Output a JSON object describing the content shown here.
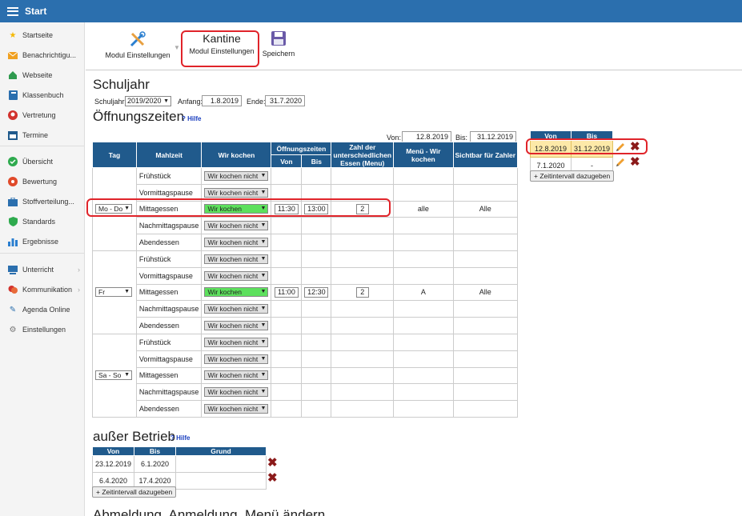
{
  "topbar": {
    "title": "Start"
  },
  "sidebar": {
    "items": [
      {
        "label": "Startseite",
        "icon": "star-icon"
      },
      {
        "label": "Benachrichtigu...",
        "icon": "envelope-icon"
      },
      {
        "label": "Webseite",
        "icon": "home-icon"
      },
      {
        "label": "Klassenbuch",
        "icon": "book-icon"
      },
      {
        "label": "Vertretung",
        "icon": "person-icon"
      },
      {
        "label": "Termine",
        "icon": "calendar-icon"
      },
      {
        "label": "Übersicht",
        "icon": "check-circle-icon"
      },
      {
        "label": "Bewertung",
        "icon": "grade-icon"
      },
      {
        "label": "Stoffverteilung...",
        "icon": "briefcase-icon"
      },
      {
        "label": "Standards",
        "icon": "shield-icon"
      },
      {
        "label": "Ergebnisse",
        "icon": "bar-chart-icon"
      },
      {
        "label": "Unterricht",
        "icon": "classroom-icon"
      },
      {
        "label": "Kommunikation",
        "icon": "chat-icon"
      },
      {
        "label": "Agenda Online",
        "icon": "pen-icon"
      },
      {
        "label": "Einstellungen",
        "icon": "gear-icon"
      }
    ]
  },
  "toolbar": {
    "modul_label": "Modul Einstellungen",
    "kantine_title": "Kantine",
    "kantine_sub": "Modul Einstellungen",
    "save_label": "Speichern"
  },
  "schuljahr": {
    "title": "Schuljahr",
    "label": "Schuljahr:",
    "value": "2019/2020",
    "anfang_label": "Anfang:",
    "anfang": "1.8.2019",
    "ende_label": "Ende:",
    "ende": "31.7.2020"
  },
  "oeffnung": {
    "title": "Öffnungszeiten",
    "hilfe": "Hilfe",
    "von_label": "Von:",
    "von": "12.8.2019",
    "bis_label": "Bis:",
    "bis": "31.12.2019",
    "headers": {
      "tag": "Tag",
      "mahlzeit": "Mahlzeit",
      "wir_kochen": "Wir kochen",
      "oeffnungszeiten": "Öffnungszeiten",
      "von": "Von",
      "bis": "Bis",
      "zahl": "Zahl der unterschiedlichen Essen (Menu)",
      "menu": "Menü - Wir kochen",
      "sichtbar": "Sichtbar für Zahler"
    },
    "groups": [
      {
        "tag": "Mo - Do",
        "rows": [
          {
            "meal": "Frühstück",
            "kochen": "Wir kochen nicht",
            "green": false,
            "von": "",
            "bis": "",
            "zahl": "",
            "menu": "",
            "sichtbar": ""
          },
          {
            "meal": "Vormittagspause",
            "kochen": "Wir kochen nicht",
            "green": false,
            "von": "",
            "bis": "",
            "zahl": "",
            "menu": "",
            "sichtbar": ""
          },
          {
            "meal": "Mittagessen",
            "kochen": "Wir kochen",
            "green": true,
            "von": "11:30",
            "bis": "13:00",
            "zahl": "2",
            "menu": "alle",
            "sichtbar": "Alle"
          },
          {
            "meal": "Nachmittagspause",
            "kochen": "Wir kochen nicht",
            "green": false,
            "von": "",
            "bis": "",
            "zahl": "",
            "menu": "",
            "sichtbar": ""
          },
          {
            "meal": "Abendessen",
            "kochen": "Wir kochen nicht",
            "green": false,
            "von": "",
            "bis": "",
            "zahl": "",
            "menu": "",
            "sichtbar": ""
          }
        ]
      },
      {
        "tag": "Fr",
        "rows": [
          {
            "meal": "Frühstück",
            "kochen": "Wir kochen nicht",
            "green": false,
            "von": "",
            "bis": "",
            "zahl": "",
            "menu": "",
            "sichtbar": ""
          },
          {
            "meal": "Vormittagspause",
            "kochen": "Wir kochen nicht",
            "green": false,
            "von": "",
            "bis": "",
            "zahl": "",
            "menu": "",
            "sichtbar": ""
          },
          {
            "meal": "Mittagessen",
            "kochen": "Wir kochen",
            "green": true,
            "von": "11:00",
            "bis": "12:30",
            "zahl": "2",
            "menu": "A",
            "sichtbar": "Alle"
          },
          {
            "meal": "Nachmittagspause",
            "kochen": "Wir kochen nicht",
            "green": false,
            "von": "",
            "bis": "",
            "zahl": "",
            "menu": "",
            "sichtbar": ""
          },
          {
            "meal": "Abendessen",
            "kochen": "Wir kochen nicht",
            "green": false,
            "von": "",
            "bis": "",
            "zahl": "",
            "menu": "",
            "sichtbar": ""
          }
        ]
      },
      {
        "tag": "Sa - So",
        "rows": [
          {
            "meal": "Frühstück",
            "kochen": "Wir kochen nicht",
            "green": false,
            "von": "",
            "bis": "",
            "zahl": "",
            "menu": "",
            "sichtbar": ""
          },
          {
            "meal": "Vormittagspause",
            "kochen": "Wir kochen nicht",
            "green": false,
            "von": "",
            "bis": "",
            "zahl": "",
            "menu": "",
            "sichtbar": ""
          },
          {
            "meal": "Mittagessen",
            "kochen": "Wir kochen nicht",
            "green": false,
            "von": "",
            "bis": "",
            "zahl": "",
            "menu": "",
            "sichtbar": ""
          },
          {
            "meal": "Nachmittagspause",
            "kochen": "Wir kochen nicht",
            "green": false,
            "von": "",
            "bis": "",
            "zahl": "",
            "menu": "",
            "sichtbar": ""
          },
          {
            "meal": "Abendessen",
            "kochen": "Wir kochen nicht",
            "green": false,
            "von": "",
            "bis": "",
            "zahl": "",
            "menu": "",
            "sichtbar": ""
          }
        ]
      }
    ]
  },
  "intervals": {
    "headers": {
      "von": "Von",
      "bis": "Bis"
    },
    "rows": [
      {
        "von": "12.8.2019",
        "bis": "31.12.2019"
      },
      {
        "von": "7.1.2020",
        "bis": "-"
      }
    ],
    "add_label": "+ Zeitintervall dazugeben"
  },
  "ausser": {
    "title": "außer Betrieb",
    "hilfe": "Hilfe",
    "headers": {
      "von": "Von",
      "bis": "Bis",
      "grund": "Grund"
    },
    "rows": [
      {
        "von": "23.12.2019",
        "bis": "6.1.2020",
        "grund": ""
      },
      {
        "von": "6.4.2020",
        "bis": "17.4.2020",
        "grund": ""
      }
    ],
    "add_label": "+ Zeitintervall dazugeben"
  },
  "bottom": {
    "title": "Abmeldung, Anmeldung, Menü ändern"
  },
  "colors": {
    "header_blue": "#205a8c",
    "topbar_blue": "#2b6fae",
    "green": "#5de05d",
    "highlight": "#fde9a8",
    "red": "#e0242a"
  }
}
